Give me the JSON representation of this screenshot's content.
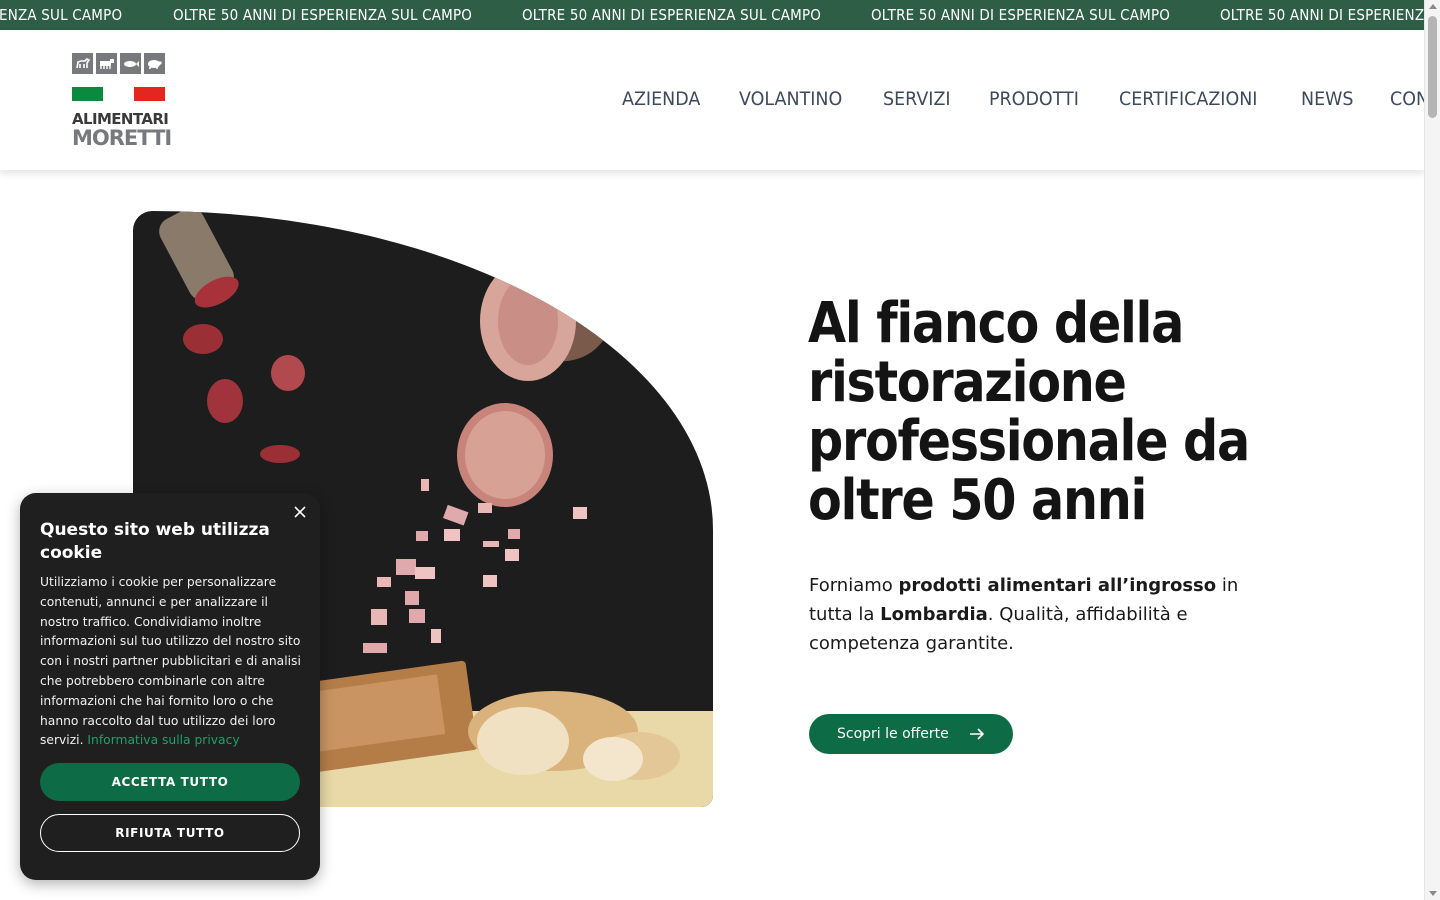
{
  "ticker": {
    "items": [
      "ENZA SUL CAMPO",
      "OLTRE 50 ANNI DI ESPERIENZA SUL CAMPO",
      "OLTRE 50 ANNI DI ESPERIENZA SUL CAMPO",
      "OLTRE 50 ANNI DI ESPERIENZA SUL CAMPO",
      "OLTRE 50 ANNI DI ESPERIENZ"
    ],
    "background": "#2e5e46"
  },
  "logo": {
    "line1": "ALIMENTARI",
    "line2": "MORETTI",
    "icons": [
      "goat-icon",
      "cow-icon",
      "fish-icon",
      "pig-icon"
    ]
  },
  "nav": {
    "items": [
      "AZIENDA",
      "VOLANTINO",
      "SERVIZI",
      "PRODOTTI",
      "CERTIFICAZIONI",
      "NEWS",
      "CONTATTI"
    ]
  },
  "hero": {
    "title": "Al fianco della ristorazione professionale da oltre 50 anni",
    "text_1": "Forniamo ",
    "text_bold_1": "prodotti alimentari all’ingrosso",
    "text_2": " in tutta la ",
    "text_bold_2": "Lombardia",
    "text_3": ". Qualità, affidabilità e competenza garantite.",
    "cta_label": "Scopri le offerte"
  },
  "cookie": {
    "title": "Questo sito web utilizza cookie",
    "body": "Utilizziamo i cookie per personalizzare contenuti, annunci e per analizzare il nostro traffico. Condividiamo inoltre informazioni sul tuo utilizzo del nostro sito con i nostri partner pubblicitari e di analisi che potrebbero combinarle con altre informazioni che hai fornito loro o che hanno raccolto dal tuo utilizzo dei loro servizi. ",
    "link": "Informativa sulla privacy",
    "accept_label": "ACCETTA TUTTO",
    "reject_label": "RIFIUTA TUTTO"
  },
  "colors": {
    "brand_green": "#0d6b45",
    "link_green": "#1aa36a",
    "nav_text": "#3d4a5c",
    "cookie_bg": "#1f1f1f"
  }
}
